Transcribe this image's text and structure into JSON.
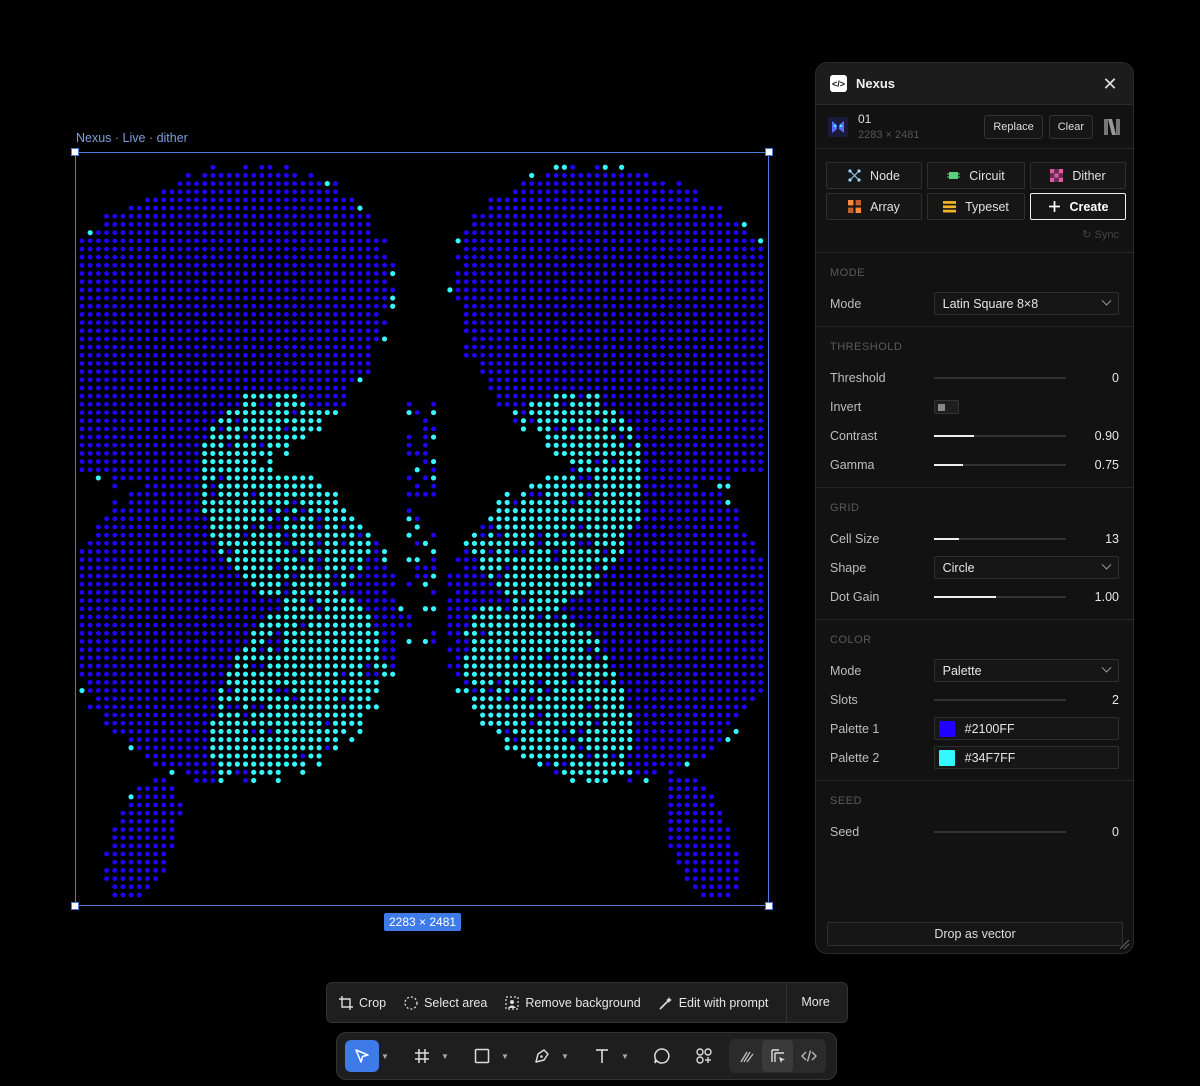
{
  "canvas": {
    "frame_label": "Nexus · Live · dither",
    "dimensions_badge": "2283 × 2481"
  },
  "panel": {
    "title": "Nexus",
    "source": {
      "name": "01",
      "dims": "2283 × 2481",
      "replace_label": "Replace",
      "clear_label": "Clear"
    },
    "tools": [
      {
        "label": "Node",
        "icon": "node-icon",
        "color": "#9fd6ff"
      },
      {
        "label": "Circuit",
        "icon": "circuit-icon",
        "color": "#5ad07a"
      },
      {
        "label": "Dither",
        "icon": "dither-icon",
        "color": "#e05aa8"
      },
      {
        "label": "Array",
        "icon": "array-icon",
        "color": "#ff8a3d"
      },
      {
        "label": "Typeset",
        "icon": "typeset-icon",
        "color": "#f0b429"
      },
      {
        "label": "Create",
        "icon": "plus-icon",
        "color": "#ffffff"
      }
    ],
    "sync_label": "↻ Sync",
    "mode": {
      "section": "MODE",
      "label": "Mode",
      "value": "Latin Square 8×8"
    },
    "threshold": {
      "section": "THRESHOLD",
      "threshold_label": "Threshold",
      "threshold_value": "0",
      "threshold_level": 0,
      "invert_label": "Invert",
      "invert_on": false,
      "contrast_label": "Contrast",
      "contrast_value": "0.90",
      "contrast_level": 0.3,
      "gamma_label": "Gamma",
      "gamma_value": "0.75",
      "gamma_level": 0.22
    },
    "grid": {
      "section": "GRID",
      "cell_label": "Cell Size",
      "cell_value": "13",
      "cell_level": 0.19,
      "shape_label": "Shape",
      "shape_value": "Circle",
      "gain_label": "Dot Gain",
      "gain_value": "1.00",
      "gain_level": 0.47
    },
    "color": {
      "section": "COLOR",
      "mode_label": "Mode",
      "mode_value": "Palette",
      "slots_label": "Slots",
      "slots_value": "2",
      "slots_level": 0,
      "palette1_label": "Palette 1",
      "palette1_value": "#2100FF",
      "palette2_label": "Palette 2",
      "palette2_value": "#34F7FF"
    },
    "seed": {
      "section": "SEED",
      "label": "Seed",
      "value": "0",
      "level": 0
    },
    "drop_label": "Drop as vector"
  },
  "action_bar": {
    "crop": "Crop",
    "select_area": "Select area",
    "remove_bg": "Remove background",
    "edit_prompt": "Edit with prompt",
    "more": "More"
  },
  "colors": {
    "accent": "#3e7ae8",
    "dot_blue": "#2100FF",
    "dot_cyan": "#34F7FF"
  }
}
